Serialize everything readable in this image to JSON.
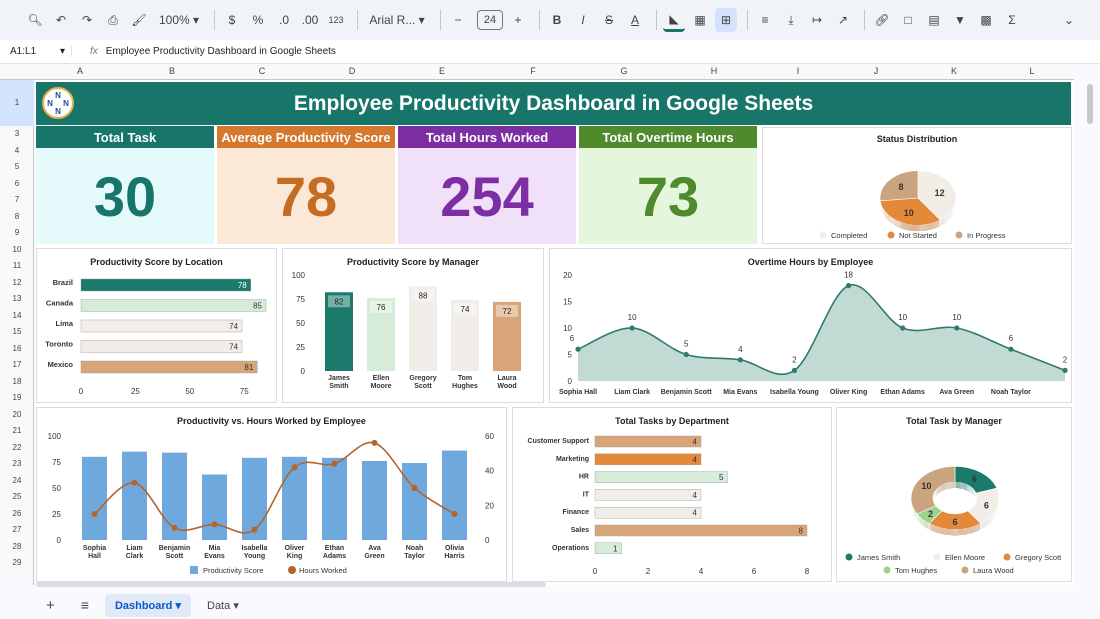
{
  "toolbar": {
    "zoom": "100%",
    "currency": "$",
    "percent": "%",
    "dec_dec": ".0",
    "dec_inc": ".00",
    "num_format": "123",
    "font": "Arial R...",
    "font_size": "24",
    "minus": "−",
    "plus": "+",
    "bold": "B",
    "italic": "I",
    "sum": "Σ"
  },
  "formula": {
    "cell_ref": "A1:L1",
    "fx": "fx",
    "content": "Employee Productivity Dashboard in Google Sheets"
  },
  "columns": [
    "A",
    "B",
    "C",
    "D",
    "E",
    "F",
    "G",
    "H",
    "I",
    "J",
    "K",
    "L"
  ],
  "rows": [
    "1",
    "3",
    "4",
    "5",
    "6",
    "7",
    "8",
    "9",
    "10",
    "11",
    "12",
    "13",
    "14",
    "15",
    "16",
    "17",
    "18",
    "19",
    "20",
    "21",
    "22",
    "23",
    "24",
    "25",
    "26",
    "27",
    "28",
    "29"
  ],
  "dashboard": {
    "title": "Employee Productivity Dashboard in Google Sheets",
    "kpis": [
      {
        "label": "Total Task",
        "value": "30",
        "head_color": "#18756a",
        "bg_color": "#e5fafb",
        "value_color": "#18756a"
      },
      {
        "label": "Average Productivity Score",
        "value": "78",
        "head_color": "#d4782d",
        "bg_color": "#fbe8d6",
        "value_color": "#c56e23"
      },
      {
        "label": "Total Hours Worked",
        "value": "254",
        "head_color": "#7b2fa3",
        "bg_color": "#f1e1f8",
        "value_color": "#7b2fa3"
      },
      {
        "label": "Total Overtime Hours",
        "value": "73",
        "head_color": "#4f8a2c",
        "bg_color": "#e4f7dc",
        "value_color": "#4f8a2c"
      }
    ]
  },
  "chart_data": [
    {
      "id": "status",
      "type": "pie",
      "title": "Status Distribution",
      "categories": [
        "Completed",
        "Not Started",
        "In Progress"
      ],
      "values": [
        12,
        10,
        8
      ],
      "colors": [
        "#f2ede6",
        "#e4893a",
        "#caa47e"
      ],
      "legend": "bottom"
    },
    {
      "id": "location",
      "type": "bar",
      "orientation": "horizontal",
      "title": "Productivity Score by Location",
      "categories": [
        "Brazil",
        "Canada",
        "Lima",
        "Toronto",
        "Mexico"
      ],
      "values": [
        78,
        85,
        74,
        74,
        81
      ],
      "colors": [
        "#1b7a6c",
        "#d6ecd9",
        "#f1ede9",
        "#f1ede9",
        "#d8a578"
      ],
      "xticks": [
        0,
        25,
        50,
        75
      ],
      "xlim": [
        0,
        85
      ]
    },
    {
      "id": "manager",
      "type": "bar",
      "title": "Productivity Score by Manager",
      "categories": [
        "James Smith",
        "Ellen Moore",
        "Gregory Scott",
        "Tom Hughes",
        "Laura Wood"
      ],
      "values": [
        82,
        76,
        88,
        74,
        72
      ],
      "colors": [
        "#1b7a6c",
        "#d6ecd9",
        "#f1ede9",
        "#f1ede9",
        "#d8a578"
      ],
      "yticks": [
        0,
        25,
        50,
        75,
        100
      ],
      "ylim": [
        0,
        100
      ]
    },
    {
      "id": "overtime",
      "type": "area",
      "title": "Overtime Hours by Employee",
      "categories": [
        "Sophia Hall",
        "Liam Clark",
        "Benjamin Scott",
        "Mia Evans",
        "Isabella Young",
        "Oliver King",
        "Ethan Adams",
        "Ava Green",
        "Noah Taylor",
        ""
      ],
      "values": [
        6,
        10,
        5,
        4,
        2,
        18,
        10,
        10,
        6,
        2
      ],
      "yticks": [
        0,
        5,
        10,
        15,
        20
      ],
      "ylim": [
        0,
        20
      ],
      "colors": [
        "#b7d3cd",
        "#2f7a6d"
      ]
    },
    {
      "id": "prodhours",
      "type": "bar",
      "title": "Productivity vs. Hours Worked by Employee",
      "categories": [
        "Sophia Hall",
        "Liam Clark",
        "Benjamin Scott",
        "Mia Evans",
        "Isabella Young",
        "Oliver King",
        "Ethan Adams",
        "Ava Green",
        "Noah Taylor",
        "Olivia Harris"
      ],
      "series": [
        {
          "name": "Productivity Score",
          "type": "bar",
          "values": [
            80,
            85,
            84,
            63,
            79,
            80,
            79,
            76,
            74,
            86
          ],
          "color": "#6fa8dc"
        },
        {
          "name": "Hours Worked",
          "type": "line",
          "axis": "right",
          "values": [
            15,
            33,
            7,
            9,
            6,
            42,
            44,
            56,
            30,
            15
          ],
          "color": "#b3652a"
        }
      ],
      "yticks": [
        0,
        25,
        50,
        75,
        100
      ],
      "ylim": [
        0,
        100
      ],
      "y2ticks": [
        0,
        20,
        40,
        60
      ],
      "y2lim": [
        0,
        60
      ],
      "legend": "bottom"
    },
    {
      "id": "dept",
      "type": "bar",
      "orientation": "horizontal",
      "title": "Total Tasks by Department",
      "categories": [
        "Customer Support",
        "Marketing",
        "HR",
        "IT",
        "Finance",
        "Sales",
        "Operations"
      ],
      "values": [
        4,
        4,
        5,
        4,
        4,
        8,
        1
      ],
      "colors": [
        "#d8a578",
        "#e4893a",
        "#d6ecd9",
        "#f1ede9",
        "#f1ede9",
        "#d8a578",
        "#d6ecd9"
      ],
      "xticks": [
        0,
        2,
        4,
        6,
        8
      ],
      "xlim": [
        0,
        8
      ]
    },
    {
      "id": "taskmgr",
      "type": "pie",
      "donut": true,
      "title": "Total Task by Manager",
      "categories": [
        "James Smith",
        "Ellen Moore",
        "Gregory Scott",
        "Tom Hughes",
        "Laura Wood"
      ],
      "values": [
        6,
        6,
        6,
        2,
        10
      ],
      "colors": [
        "#1b7a6c",
        "#f2ede6",
        "#e4893a",
        "#9ad38a",
        "#caa47e"
      ],
      "legend": "bottom"
    }
  ],
  "tabs": [
    "Dashboard",
    "Data"
  ]
}
